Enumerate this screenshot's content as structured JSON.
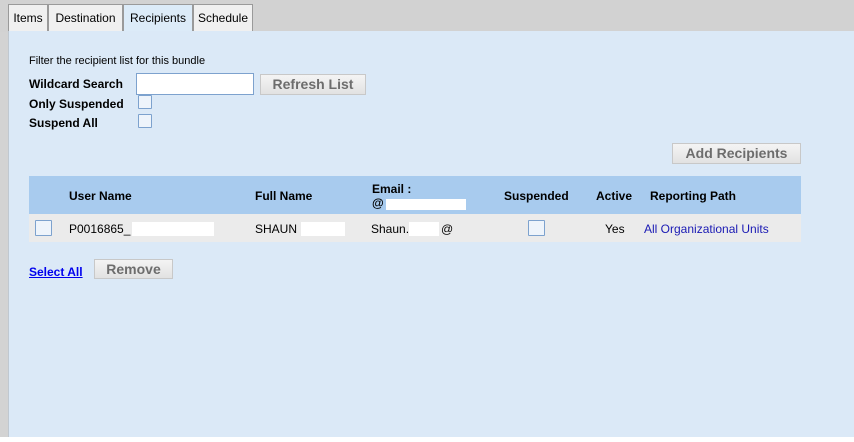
{
  "tabs": [
    {
      "label": "Items"
    },
    {
      "label": "Destination"
    },
    {
      "label": "Recipients"
    },
    {
      "label": "Schedule"
    }
  ],
  "active_tab": "Recipients",
  "filter": {
    "heading": "Filter the recipient list for this bundle",
    "wildcard_label": "Wildcard Search",
    "wildcard_value": "",
    "refresh_label": "Refresh List",
    "only_suspended_label": "Only Suspended",
    "only_suspended_checked": false,
    "suspend_all_label": "Suspend All",
    "suspend_all_checked": false
  },
  "add_recipients_label": "Add Recipients",
  "table": {
    "headers": {
      "user_name": "User Name",
      "full_name": "Full Name",
      "email": "Email :",
      "email_at": "@",
      "suspended": "Suspended",
      "active": "Active",
      "reporting_path": "Reporting Path"
    },
    "rows": [
      {
        "user_name": "P0016865_",
        "full_name": "SHAUN",
        "email_prefix": "Shaun.",
        "email_at": "@",
        "suspended": false,
        "active": "Yes",
        "reporting_path": "All Organizational Units"
      }
    ]
  },
  "footer": {
    "select_all_label": "Select All",
    "remove_label": "Remove"
  },
  "colors": {
    "panel_bg": "#dbe9f7",
    "header_bg": "#a8cbee",
    "row_bg": "#ebebeb",
    "link": "#1a1ab4"
  }
}
